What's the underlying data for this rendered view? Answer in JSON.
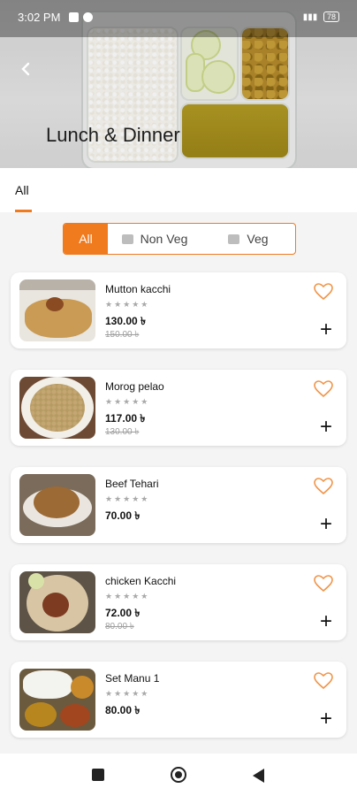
{
  "status_bar": {
    "time": "3:02 PM",
    "battery": "78"
  },
  "header": {
    "title": "Lunch & Dinner",
    "back_icon": "chevron-left-icon"
  },
  "tabs": [
    {
      "label": "All",
      "active": true
    }
  ],
  "filter": {
    "all_label": "All",
    "non_veg_label": "Non Veg",
    "veg_label": "Veg",
    "selected": "All",
    "accent": "#f07a1e"
  },
  "items": [
    {
      "name": "Mutton kacchi",
      "rating": "★★★★★",
      "price": "130.00 ৳",
      "old_price": "150.00 ৳"
    },
    {
      "name": "Morog pelao",
      "rating": "★★★★★",
      "price": "117.00 ৳",
      "old_price": "130.00 ৳"
    },
    {
      "name": "Beef Tehari",
      "rating": "★★★★★",
      "price": "70.00 ৳",
      "old_price": ""
    },
    {
      "name": "chicken Kacchi",
      "rating": "★★★★★",
      "price": "72.00 ৳",
      "old_price": "80.00 ৳"
    },
    {
      "name": "Set Manu 1",
      "rating": "★★★★★",
      "price": "80.00 ৳",
      "old_price": ""
    }
  ],
  "bottom_nav": {
    "icons": [
      "recents-icon",
      "home-icon",
      "back-icon"
    ]
  }
}
